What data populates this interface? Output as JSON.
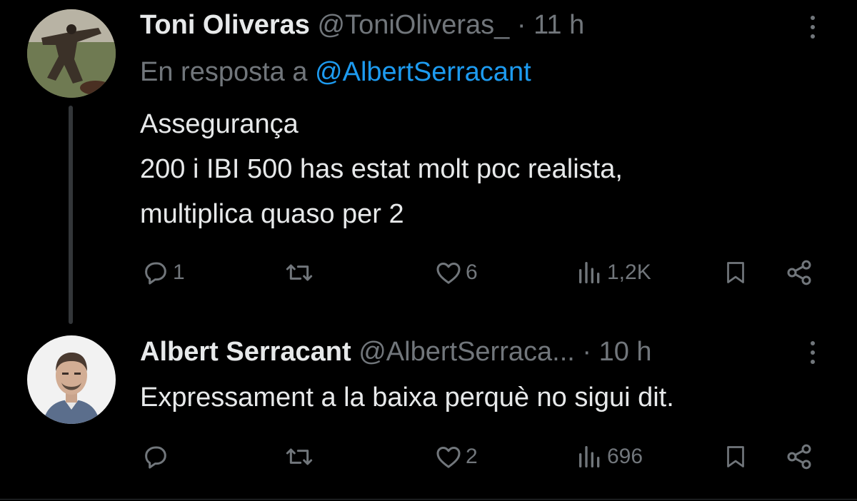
{
  "tweets": [
    {
      "author_name": "Toni Oliveras",
      "handle": "@ToniOliveras_",
      "separator": "·",
      "time": "11 h",
      "reply_prefix": "En resposta a",
      "reply_to": "@AlbertSerracant",
      "text_lines": [
        "Assegurança",
        "200 i IBI 500 has estat molt poc realista,",
        "multiplica quaso per 2"
      ],
      "replies": "1",
      "retweets": "",
      "likes": "6",
      "views": "1,2K"
    },
    {
      "author_name": "Albert Serracant",
      "handle": "@AlbertSerraca...",
      "separator": "·",
      "time": "10 h",
      "text_lines": [
        "Expressament a la baixa perquè no sigui dit."
      ],
      "replies": "",
      "retweets": "",
      "likes": "2",
      "views": "696"
    }
  ],
  "icons": {
    "reply": "reply-icon",
    "retweet": "retweet-icon",
    "like": "heart-icon",
    "views": "views-icon",
    "bookmark": "bookmark-icon",
    "share": "share-icon",
    "more": "more-icon"
  },
  "colors": {
    "background": "#000000",
    "text": "#e7e9ea",
    "secondary": "#71767b",
    "link": "#1d9bf0"
  }
}
